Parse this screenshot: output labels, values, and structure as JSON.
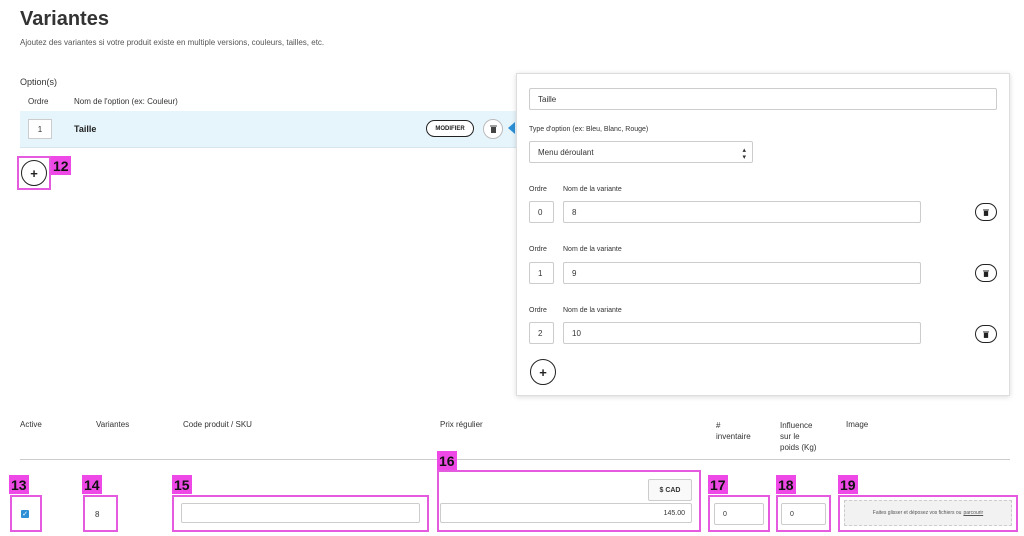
{
  "header": {
    "title": "Variantes",
    "subtitle": "Ajoutez des variantes si votre produit existe en multiple versions, couleurs, tailles, etc."
  },
  "options": {
    "label": "Option(s)",
    "col_order": "Ordre",
    "col_name": "Nom de l'option (ex: Couleur)",
    "rows": [
      {
        "order": "1",
        "name": "Taille",
        "modify_label": "MODIFIER"
      }
    ]
  },
  "panel": {
    "name_value": "Taille",
    "type_label": "Type d'option (ex: Bleu, Blanc, Rouge)",
    "type_value": "Menu déroulant",
    "variants": [
      {
        "order_label": "Ordre",
        "name_label": "Nom de la variante",
        "order": "0",
        "name": "8"
      },
      {
        "order_label": "Ordre",
        "name_label": "Nom de la variante",
        "order": "1",
        "name": "9"
      },
      {
        "order_label": "Ordre",
        "name_label": "Nom de la variante",
        "order": "2",
        "name": "10"
      }
    ]
  },
  "table": {
    "headers": {
      "active": "Active",
      "variants": "Variantes",
      "sku": "Code produit / SKU",
      "price": "Prix régulier",
      "inventory_1": "#",
      "inventory_2": "inventaire",
      "weight_1": "Influence",
      "weight_2": "sur le",
      "weight_3": "poids (Kg)",
      "image": "Image"
    },
    "row": {
      "active": true,
      "variant": "8",
      "sku": "",
      "currency": "$ CAD",
      "price": "145.00",
      "inventory": "0",
      "weight": "0",
      "dropzone_text": "Faites glisser et déposez vos fichiers ou",
      "dropzone_link": "parcourir"
    }
  },
  "annotations": [
    "12",
    "13",
    "14",
    "15",
    "16",
    "17",
    "18",
    "19"
  ],
  "colors": {
    "highlight": "#ee48e6",
    "accent": "#2d8fd5",
    "row_selected": "#e6f4fb"
  }
}
